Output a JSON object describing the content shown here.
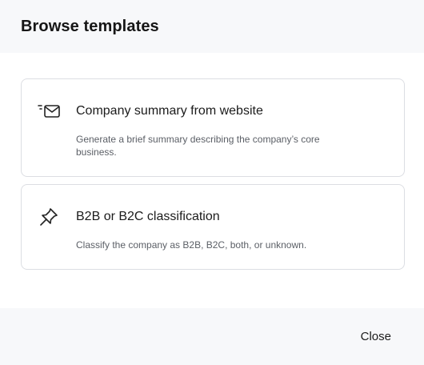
{
  "dialog": {
    "title": "Browse templates",
    "close_label": "Close"
  },
  "templates": [
    {
      "icon": "email-send-icon",
      "title": "Company summary from website",
      "description": "Generate a brief summary describing the company’s core business."
    },
    {
      "icon": "pin-icon",
      "title": "B2B or B2C classification",
      "description": "Classify the company as B2B, B2C, both, or unknown."
    }
  ]
}
